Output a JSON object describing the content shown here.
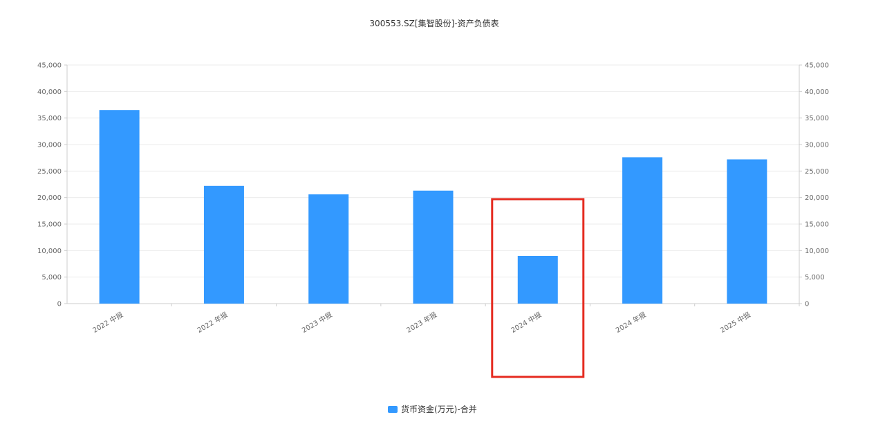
{
  "chart_data": {
    "type": "bar",
    "title": "300553.SZ[集智股份]-资产负债表",
    "categories": [
      "2022 中报",
      "2022 年报",
      "2023 中报",
      "2023 年报",
      "2024 中报",
      "2024 年报",
      "2025 中报"
    ],
    "series": [
      {
        "name": "货币资金(万元)-合并",
        "values": [
          36500,
          22200,
          20600,
          21300,
          9000,
          27600,
          27200
        ],
        "color": "#3399ff"
      }
    ],
    "ylim": [
      0,
      45000
    ],
    "y_ticks": [
      0,
      5000,
      10000,
      15000,
      20000,
      25000,
      30000,
      35000,
      40000,
      45000
    ],
    "y_tick_labels": [
      "0",
      "5,000",
      "10,000",
      "15,000",
      "20,000",
      "25,000",
      "30,000",
      "35,000",
      "40,000",
      "45,000"
    ],
    "dual_y_axis": true,
    "grid": true,
    "legend_position": "bottom-center",
    "highlight": {
      "category": "2024 中报",
      "color": "#e52b20"
    }
  }
}
